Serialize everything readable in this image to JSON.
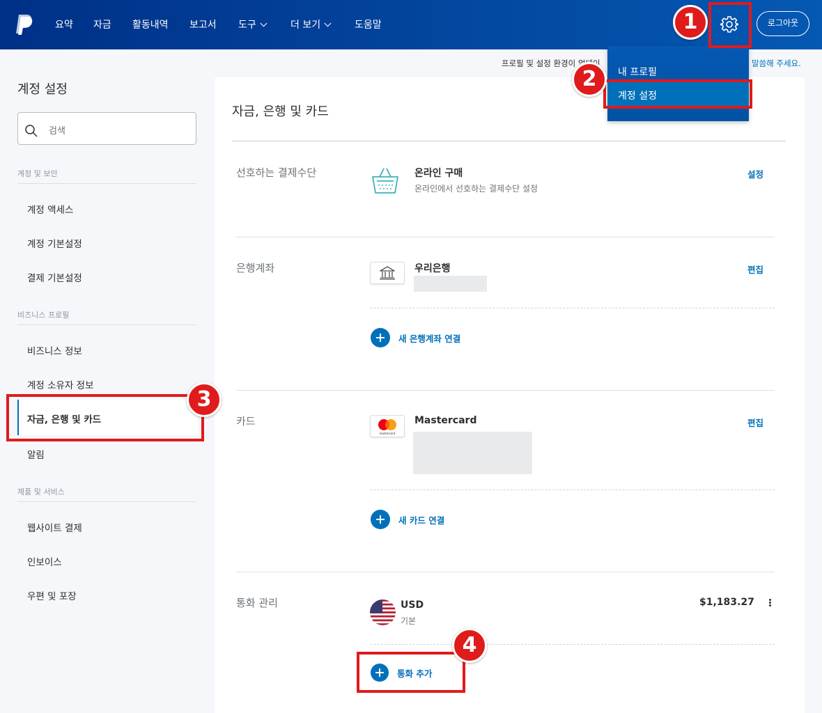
{
  "nav": {
    "items": [
      {
        "label": "요약",
        "chevron": false
      },
      {
        "label": "자금",
        "chevron": false
      },
      {
        "label": "활동내역",
        "chevron": false
      },
      {
        "label": "보고서",
        "chevron": false
      },
      {
        "label": "도구",
        "chevron": true
      },
      {
        "label": "더 보기",
        "chevron": true
      },
      {
        "label": "도움말",
        "chevron": false
      }
    ],
    "logout_label": "로그아웃",
    "logo_icon": "paypal-logo",
    "settings_icon": "gear-icon"
  },
  "notice": {
    "text": "프로필 및 설정 환경이 업데이",
    "link_text": "말씀해 주세요."
  },
  "dropdown": {
    "items": [
      "내 프로필",
      "계정 설정"
    ],
    "active_index": 1
  },
  "sidebar": {
    "title": "계정 설정",
    "search_placeholder": "검색",
    "sections": [
      {
        "title": "계정 및 보안",
        "items": [
          "계정 액세스",
          "계정 기본설정",
          "결제 기본설정"
        ]
      },
      {
        "title": "비즈니스 프로필",
        "items": [
          "비즈니스 정보",
          "계정 소유자 정보",
          "자금, 은행 및 카드",
          "알림"
        ]
      },
      {
        "title": "제품 및 서비스",
        "items": [
          "웹사이트 결제",
          "인보이스",
          "우편 및 포장"
        ]
      }
    ],
    "active_item": "자금, 은행 및 카드"
  },
  "main": {
    "title": "자금, 은행 및 카드",
    "preferred": {
      "label": "선호하는 결제수단",
      "item_title": "온라인 구매",
      "item_sub": "온라인에서 선호하는 결제수단 설정",
      "action": "설정",
      "icon": "shopping-basket-icon"
    },
    "bank": {
      "label": "은행계좌",
      "item_title": "우리은행",
      "action": "편집",
      "add_label": "새 은행계좌 연결",
      "icon": "bank-icon"
    },
    "card": {
      "label": "카드",
      "item_title": "Mastercard",
      "action": "편집",
      "add_label": "새 카드 연결",
      "icon": "mastercard-icon"
    },
    "currency": {
      "label": "통화 관리",
      "code": "USD",
      "sub": "기본",
      "balance": "$1,183.27",
      "add_label": "통화 추가",
      "icon": "us-flag-icon"
    }
  },
  "annotations": {
    "badges": [
      "1",
      "2",
      "3",
      "4"
    ],
    "color": "#e01b1b"
  },
  "colors": {
    "nav_bg": "#003087",
    "accent": "#0070ba",
    "dropdown_bg": "#0052a3"
  }
}
